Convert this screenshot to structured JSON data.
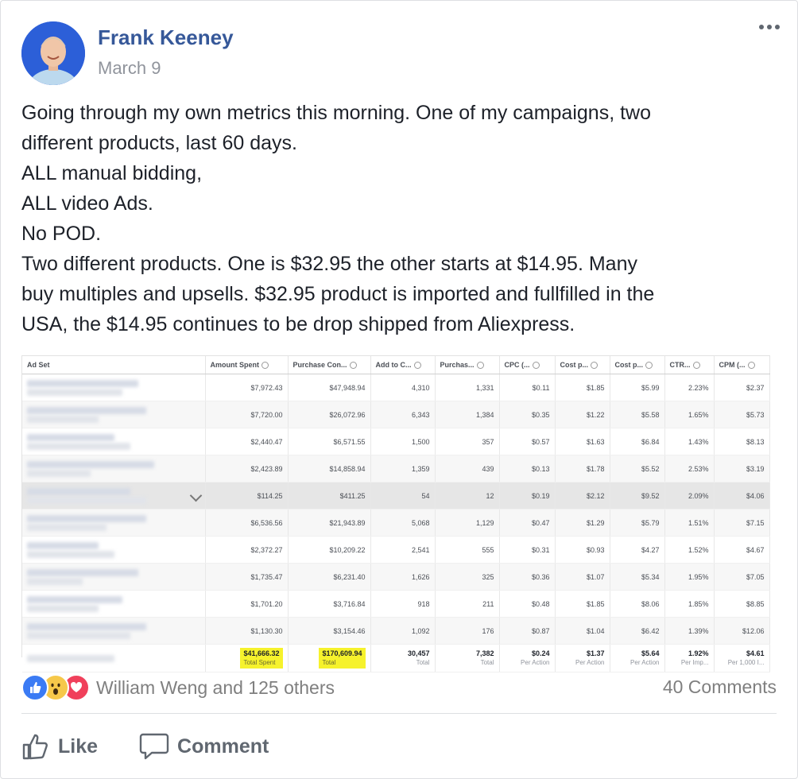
{
  "post": {
    "author": "Frank Keeney",
    "date": "March 9",
    "text_lines": [
      "Going through my own metrics this morning. One of my campaigns, two",
      "different products, last 60 days.",
      "ALL manual bidding,",
      "ALL video Ads.",
      "No POD.",
      "Two different products. One is $32.95 the other starts at $14.95. Many",
      "buy multiples and upsells. $32.95 product is imported and fullfilled in the",
      "USA, the $14.95 continues to be drop shipped from Aliexpress."
    ]
  },
  "table": {
    "headers": [
      "Ad Set",
      "Amount Spent",
      "Purchase Con...",
      "Add to C...",
      "Purchas...",
      "CPC (...",
      "Cost p...",
      "Cost p...",
      "CTR...",
      "CPM (..."
    ],
    "rows": [
      [
        "$7,972.43",
        "$47,948.94",
        "4,310",
        "1,331",
        "$0.11",
        "$1.85",
        "$5.99",
        "2.23%",
        "$2.37"
      ],
      [
        "$7,720.00",
        "$26,072.96",
        "6,343",
        "1,384",
        "$0.35",
        "$1.22",
        "$5.58",
        "1.65%",
        "$5.73"
      ],
      [
        "$2,440.47",
        "$6,571.55",
        "1,500",
        "357",
        "$0.57",
        "$1.63",
        "$6.84",
        "1.43%",
        "$8.13"
      ],
      [
        "$2,423.89",
        "$14,858.94",
        "1,359",
        "439",
        "$0.13",
        "$1.78",
        "$5.52",
        "2.53%",
        "$3.19"
      ],
      [
        "$114.25",
        "$411.25",
        "54",
        "12",
        "$0.19",
        "$2.12",
        "$9.52",
        "2.09%",
        "$4.06"
      ],
      [
        "$6,536.56",
        "$21,943.89",
        "5,068",
        "1,129",
        "$0.47",
        "$1.29",
        "$5.79",
        "1.51%",
        "$7.15"
      ],
      [
        "$2,372.27",
        "$10,209.22",
        "2,541",
        "555",
        "$0.31",
        "$0.93",
        "$4.27",
        "1.52%",
        "$4.67"
      ],
      [
        "$1,735.47",
        "$6,231.40",
        "1,626",
        "325",
        "$0.36",
        "$1.07",
        "$5.34",
        "1.95%",
        "$7.05"
      ],
      [
        "$1,701.20",
        "$3,716.84",
        "918",
        "211",
        "$0.48",
        "$1.85",
        "$8.06",
        "1.85%",
        "$8.85"
      ],
      [
        "$1,130.30",
        "$3,154.46",
        "1,092",
        "176",
        "$0.87",
        "$1.04",
        "$6.42",
        "1.39%",
        "$12.06"
      ]
    ],
    "totals": [
      {
        "value": "$41,666.32",
        "label": "Total Spent",
        "highlight": true
      },
      {
        "value": "$170,609.94",
        "label": "Total",
        "highlight": true
      },
      {
        "value": "30,457",
        "label": "Total"
      },
      {
        "value": "7,382",
        "label": "Total"
      },
      {
        "value": "$0.24",
        "label": "Per Action"
      },
      {
        "value": "$1.37",
        "label": "Per Action"
      },
      {
        "value": "$5.64",
        "label": "Per Action"
      },
      {
        "value": "1.92%",
        "label": "Per Imp..."
      },
      {
        "value": "$4.61",
        "label": "Per 1,000 I..."
      }
    ],
    "highlight_color": "#f6f22c"
  },
  "reactions": {
    "icons": [
      "like-icon",
      "wow-icon",
      "love-icon"
    ],
    "names": "William Weng and 125 others",
    "comments": "40 Comments"
  },
  "actions": {
    "like_label": "Like",
    "comment_label": "Comment"
  },
  "colors": {
    "author_link": "#365899",
    "like_blue": "#3b7bf4",
    "love_red": "#f0405b",
    "wow_yellow": "#f6c84a"
  }
}
